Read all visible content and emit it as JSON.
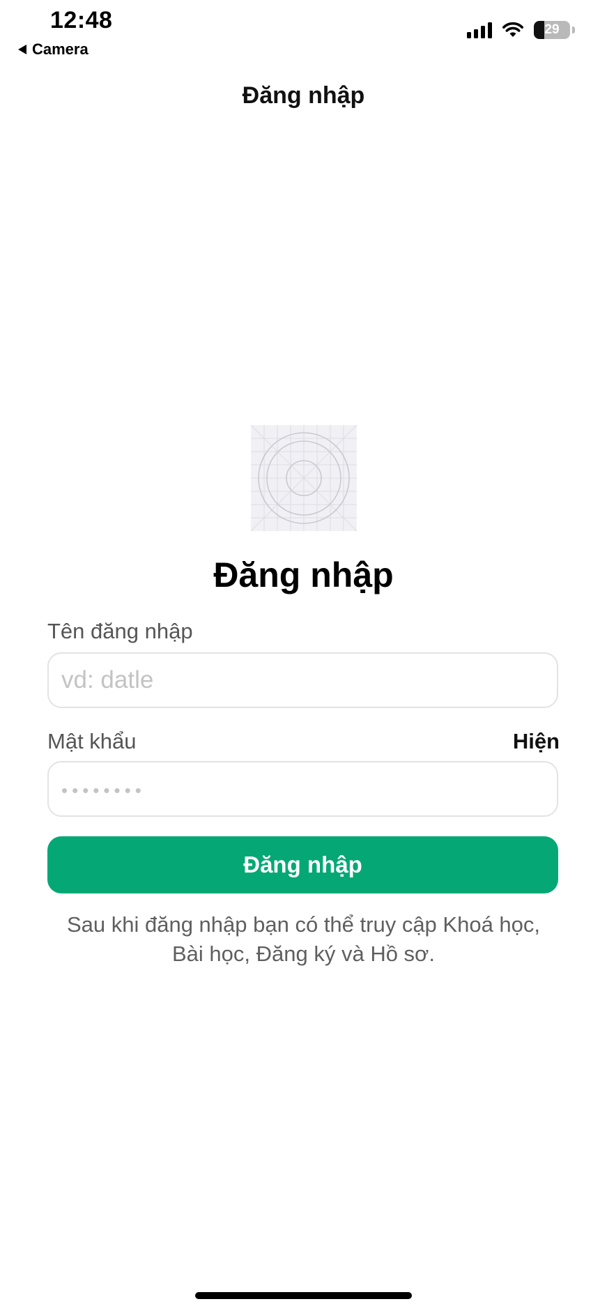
{
  "status_bar": {
    "time": "12:48",
    "back_app": "Camera",
    "battery_percent": "29",
    "battery_level": 0.29,
    "icons": [
      "signal-icon",
      "wifi-icon",
      "battery-icon"
    ]
  },
  "nav": {
    "title": "Đăng nhập"
  },
  "logo": {
    "icon": "app-logo-placeholder-icon"
  },
  "form": {
    "heading": "Đăng nhập",
    "username_label": "Tên đăng nhập",
    "username_placeholder": "vd: datle",
    "username_value": "",
    "password_label": "Mật khẩu",
    "show_password_label": "Hiện",
    "password_placeholder": "••••••••",
    "password_value": "",
    "submit_label": "Đăng nhập",
    "note": "Sau khi đăng nhập bạn có thể truy cập Khoá học, Bài học, Đăng ký và Hồ sơ."
  },
  "colors": {
    "accent": "#05a874",
    "label": "#555555",
    "note": "#5f5f5f",
    "field_border": "#e3e3e3",
    "placeholder": "#c3c3c3"
  }
}
